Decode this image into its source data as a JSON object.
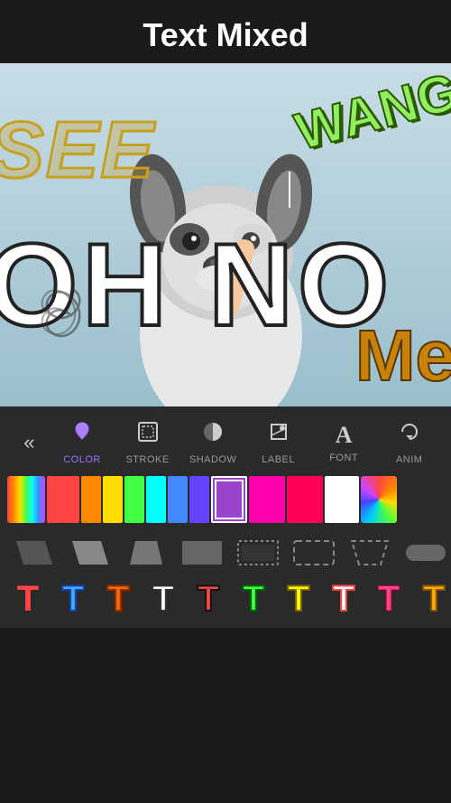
{
  "header": {
    "title": "Text Mixed"
  },
  "canvas": {
    "texts": {
      "see": "SEE",
      "wang": "WANG",
      "oh_no": "OH NO",
      "me": "Me"
    }
  },
  "toolbar": {
    "back_label": "«",
    "items": [
      {
        "id": "color",
        "label": "COLOR",
        "icon": "💧",
        "active": true
      },
      {
        "id": "stroke",
        "label": "STROKE",
        "icon": "⊞",
        "active": false
      },
      {
        "id": "shadow",
        "label": "SHADOW",
        "icon": "◑",
        "active": false
      },
      {
        "id": "label",
        "label": "LABEL",
        "icon": "▷",
        "active": false
      },
      {
        "id": "font",
        "label": "FONT",
        "icon": "A",
        "active": false
      },
      {
        "id": "anim",
        "label": "ANIM",
        "icon": "↺",
        "active": false
      }
    ]
  },
  "colors": [
    {
      "id": "c1",
      "color": "#ff4444",
      "width": 38
    },
    {
      "id": "c2",
      "color": "#ff8c00",
      "width": 22
    },
    {
      "id": "c3",
      "color": "#ffdd00",
      "width": 22
    },
    {
      "id": "c4",
      "color": "#44ff44",
      "width": 22
    },
    {
      "id": "c5",
      "color": "#00ffff",
      "width": 22
    },
    {
      "id": "c6",
      "color": "#4488ff",
      "width": 22
    },
    {
      "id": "c7",
      "color": "#8844ff",
      "width": 22
    },
    {
      "id": "c8",
      "color": "#cc44cc",
      "width": 38,
      "selected": true
    },
    {
      "id": "c9",
      "color": "#ff00aa",
      "width": 38
    },
    {
      "id": "c10",
      "color": "#ff0055",
      "width": 38
    },
    {
      "id": "c11",
      "color": "#ffffff",
      "width": 38
    },
    {
      "id": "c12",
      "color": "multicolor",
      "width": 38
    }
  ],
  "shapes": [
    {
      "id": "s1",
      "type": "parallelogram-dark"
    },
    {
      "id": "s2",
      "type": "parallelogram-mid"
    },
    {
      "id": "s3",
      "type": "trapezoid"
    },
    {
      "id": "s4",
      "type": "rectangle-outline"
    },
    {
      "id": "s5",
      "type": "rectangle-dotted"
    },
    {
      "id": "s6",
      "type": "rectangle-dashed"
    },
    {
      "id": "s7",
      "type": "parallelogram-outline"
    },
    {
      "id": "s8",
      "type": "pill"
    }
  ],
  "font_styles": [
    {
      "id": "f1",
      "char": "T",
      "color": "#ff4444",
      "stroke": "none",
      "style": "bold"
    },
    {
      "id": "f2",
      "char": "T",
      "color": "#44aaff",
      "stroke": "#1144aa",
      "style": "bold-stroke"
    },
    {
      "id": "f3",
      "char": "T",
      "color": "#ff6600",
      "stroke": "#883300",
      "style": "bold-3d"
    },
    {
      "id": "f4",
      "char": "T",
      "color": "white",
      "stroke": "#333",
      "style": "outline"
    },
    {
      "id": "f5",
      "char": "T",
      "color": "#ff4444",
      "stroke": "#333",
      "style": "outline-red"
    },
    {
      "id": "f6",
      "char": "T",
      "color": "#44ff44",
      "stroke": "#006600",
      "style": "outline-green"
    },
    {
      "id": "f7",
      "char": "T",
      "color": "#ffff00",
      "stroke": "#886600",
      "style": "yellow"
    },
    {
      "id": "f8",
      "char": "T",
      "color": "white",
      "stroke": "#ff4444",
      "style": "white-red"
    },
    {
      "id": "f9",
      "char": "T",
      "color": "#ff4444",
      "stroke": "none",
      "style": "gradient"
    },
    {
      "id": "f10",
      "char": "T",
      "color": "#ffaa00",
      "stroke": "#885500",
      "style": "gold"
    }
  ]
}
